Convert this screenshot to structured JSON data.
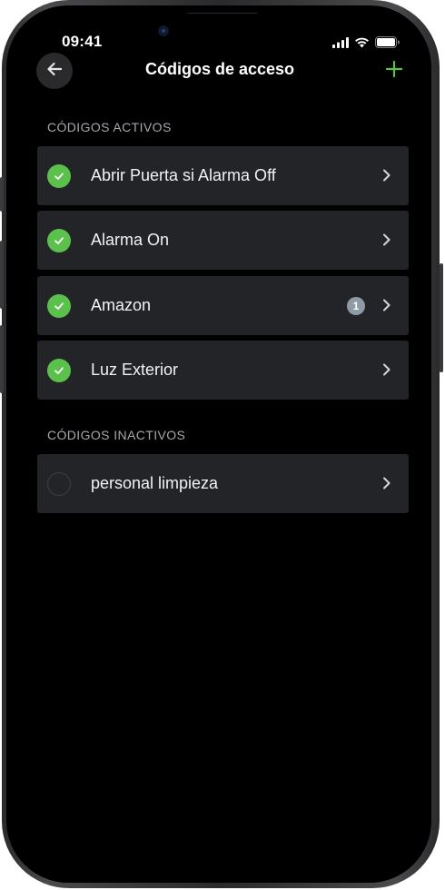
{
  "status_bar": {
    "time": "09:41"
  },
  "nav": {
    "title": "Códigos de acceso",
    "back_icon": "arrow-left-icon",
    "add_icon": "plus-icon"
  },
  "colors": {
    "accent_green": "#5cc14c",
    "row_background": "#232427",
    "section_text": "#a4a8ae",
    "badge": "#8f9aa7"
  },
  "sections": {
    "active": {
      "title": "CÓDIGOS ACTIVOS",
      "items": [
        {
          "label": "Abrir Puerta si Alarma Off",
          "active": true,
          "badge": null
        },
        {
          "label": "Alarma On",
          "active": true,
          "badge": null
        },
        {
          "label": "Amazon",
          "active": true,
          "badge": "1"
        },
        {
          "label": "Luz Exterior",
          "active": true,
          "badge": null
        }
      ]
    },
    "inactive": {
      "title": "CÓDIGOS INACTIVOS",
      "items": [
        {
          "label": "personal limpieza",
          "active": false,
          "badge": null
        }
      ]
    }
  }
}
